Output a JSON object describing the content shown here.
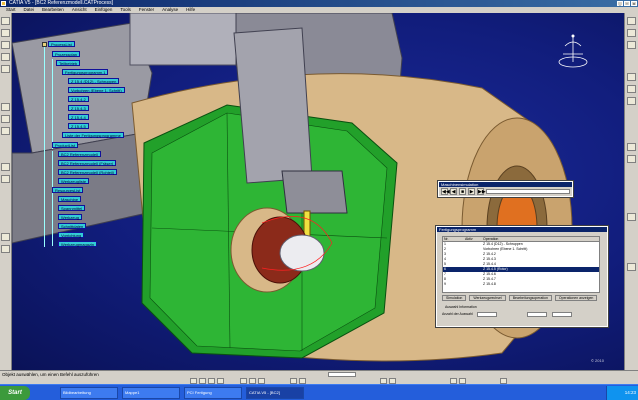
{
  "window": {
    "title": "CATIA V5 - [BC2 Referenzmodell.CATProcess]",
    "controls": [
      "_",
      "▫",
      "x"
    ]
  },
  "menu": [
    "Start",
    "Datei",
    "Bearbeiten",
    "Ansicht",
    "Einfügen",
    "Tools",
    "Fenster",
    "Analyse",
    "Hilfe"
  ],
  "tree": {
    "root": "ProcessList",
    "items": [
      "Prozessplan",
      "Teilbetrieb",
      "Fertigungsprogramm.1",
      "Z 15.4 (D12) - Schruppen",
      "Vorbohren (Ebene 1. Schritt)",
      "Z 15.4.2",
      "Z 15.4.3",
      "Z 15.4.4",
      "Z 15.4.5",
      "Liste der Fertigungsprogramme",
      "ProductList",
      "BC2 Referenzmodell",
      "BC2 Referenzmodell (Fräser)",
      "BC2 Referenzmodell (Rohteil)",
      "Werkzeugliste",
      "ResourcesList",
      "Maschine",
      "Spannmittel",
      "Werkzeug",
      "Schnittdaten",
      "Vorrichtung",
      "Werkzeugmagazin"
    ]
  },
  "simulation": {
    "title": "Maschinensimulation",
    "controls": [
      "◀◀",
      "◀",
      "■",
      "▶",
      "▶▶"
    ]
  },
  "operations": {
    "title": "Fertigungsprogramm",
    "columns": [
      "Nr.",
      "Aktiv",
      "Operation"
    ],
    "rows": [
      [
        "1",
        "",
        "Z 15.4 (D12) - Schruppen"
      ],
      [
        "2",
        "",
        "Vorbohren (Ebene 1. Schritt)"
      ],
      [
        "3",
        "",
        "Z 15.4.2"
      ],
      [
        "4",
        "",
        "Z 15.4.3"
      ],
      [
        "5",
        "",
        "Z 15.4.4"
      ],
      [
        "6",
        "",
        "Z 15.4.5 (Rotor)"
      ],
      [
        "7",
        "",
        "Z 15.4.6"
      ],
      [
        "8",
        "",
        "Z 15.4.7"
      ],
      [
        "9",
        "",
        "Z 15.4.8"
      ]
    ],
    "selected_row": 5,
    "buttons": [
      "Simulation",
      "Werkzeugwechsel",
      "Bearbeitungsoperation",
      "Operationen anzeigen"
    ],
    "fields": {
      "info_label": "Auswahl Information",
      "count_label": "Anzahl der Auswahl"
    }
  },
  "status": {
    "message": "Objekt auswählen, um einen Befehl auszuführen",
    "watermark": "© 2010"
  },
  "taskbar": {
    "start": "Start",
    "tasks": [
      "Bildbearbeitung",
      "Mappe1",
      "PCI Fertigung",
      "CATIA V5 - [BC2]"
    ],
    "active_task": 3,
    "clock": "14:23"
  },
  "icons": {
    "compass": "compass-icon",
    "sim": "play-icon",
    "start": "windows-logo-icon"
  },
  "colors": {
    "background": "#111d7c",
    "machine_green": "#22a02a",
    "part_tan": "#d8b888",
    "tree_node": "#33ccd6",
    "title_bar": "#0a246a"
  }
}
